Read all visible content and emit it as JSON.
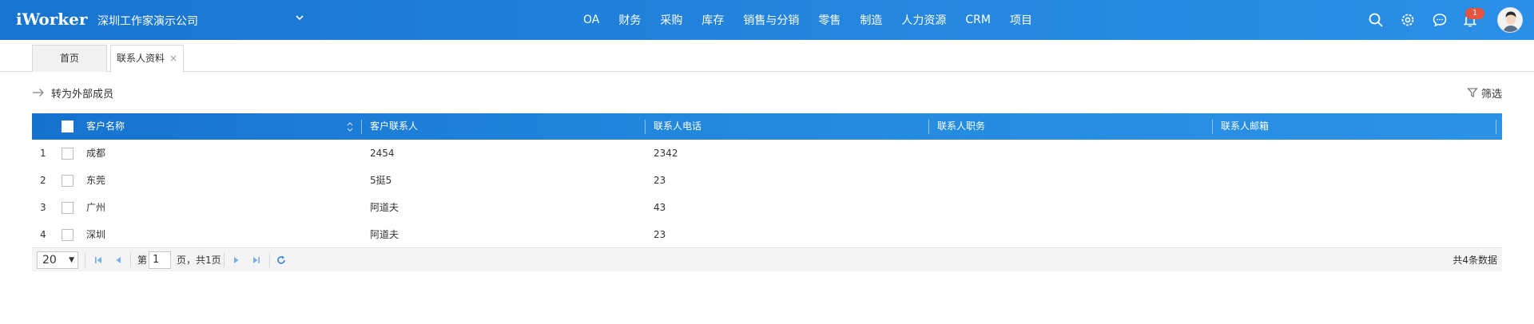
{
  "header": {
    "logo": "iWorker",
    "company": "深圳工作家演示公司",
    "nav": [
      "OA",
      "财务",
      "采购",
      "库存",
      "销售与分销",
      "零售",
      "制造",
      "人力资源",
      "CRM",
      "项目"
    ],
    "notification_count": "1",
    "icons": [
      "search-icon",
      "gear-icon",
      "chat-icon",
      "bell-icon"
    ]
  },
  "tabs": {
    "home": "首页",
    "active": "联系人资料",
    "close": "×"
  },
  "toolbar": {
    "convert_label": "转为外部成员",
    "filter_label": "筛选"
  },
  "table": {
    "columns": [
      "客户名称",
      "客户联系人",
      "联系人电话",
      "联系人职务",
      "联系人邮箱"
    ],
    "rows": [
      {
        "num": "1",
        "name": "成都",
        "contact": "2454",
        "phone": "2342",
        "title": "",
        "email": ""
      },
      {
        "num": "2",
        "name": "东莞",
        "contact": "5挺5",
        "phone": "23",
        "title": "",
        "email": ""
      },
      {
        "num": "3",
        "name": "广州",
        "contact": "阿道夫",
        "phone": "43",
        "title": "",
        "email": ""
      },
      {
        "num": "4",
        "name": "深圳",
        "contact": "阿道夫",
        "phone": "23",
        "title": "",
        "email": ""
      }
    ]
  },
  "pager": {
    "page_size": "20",
    "page_prefix": "第",
    "page_value": "1",
    "page_suffix": "页，共1页",
    "total": "共4条数据"
  },
  "colors": {
    "header_blue": "#1874d0",
    "badge_red": "#e8533d",
    "pager_icon_blue": "#4a90d9"
  }
}
